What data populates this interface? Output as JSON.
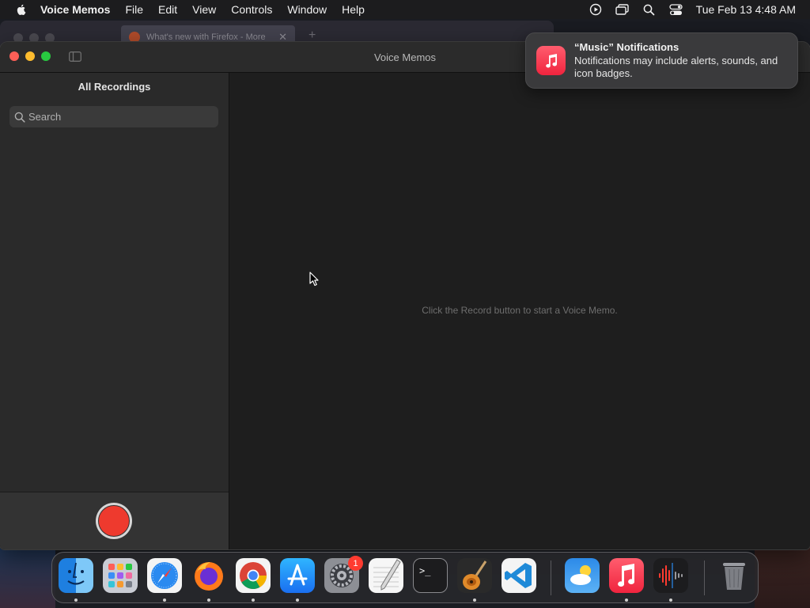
{
  "menubar": {
    "app_name": "Voice Memos",
    "items": [
      "File",
      "Edit",
      "View",
      "Controls",
      "Window",
      "Help"
    ],
    "clock": "Tue Feb 13  4:48 AM",
    "status_icons": [
      "screen-record-icon",
      "screen-mirroring-icon",
      "spotlight-icon",
      "control-center-icon"
    ]
  },
  "background_window": {
    "tab_title": "What's new with Firefox - More"
  },
  "window": {
    "title": "Voice Memos"
  },
  "sidebar": {
    "heading": "All Recordings",
    "search_placeholder": "Search"
  },
  "main": {
    "empty_message": "Click the Record button to start a Voice Memo."
  },
  "notification": {
    "title": "“Music” Notifications",
    "body": "Notifications may include alerts, sounds, and icon badges."
  },
  "dock": {
    "items": [
      {
        "name": "finder",
        "running": true
      },
      {
        "name": "launchpad",
        "running": false
      },
      {
        "name": "safari",
        "running": true
      },
      {
        "name": "firefox",
        "running": true
      },
      {
        "name": "chrome",
        "running": true
      },
      {
        "name": "app-store",
        "running": true
      },
      {
        "name": "system-settings",
        "running": false,
        "badge": "1"
      },
      {
        "name": "textedit",
        "running": false
      },
      {
        "name": "terminal",
        "running": false
      },
      {
        "name": "garageband",
        "running": true
      },
      {
        "name": "vscode",
        "running": false
      },
      {
        "name": "weather",
        "running": false
      },
      {
        "name": "music",
        "running": true
      },
      {
        "name": "voice-memos",
        "running": true
      },
      {
        "name": "trash",
        "running": false
      }
    ]
  },
  "colors": {
    "record_red": "#ee3a2e",
    "music_red": "#f0243e",
    "close": "#ff5f57",
    "minimize": "#febc2e",
    "zoom": "#28c840"
  }
}
